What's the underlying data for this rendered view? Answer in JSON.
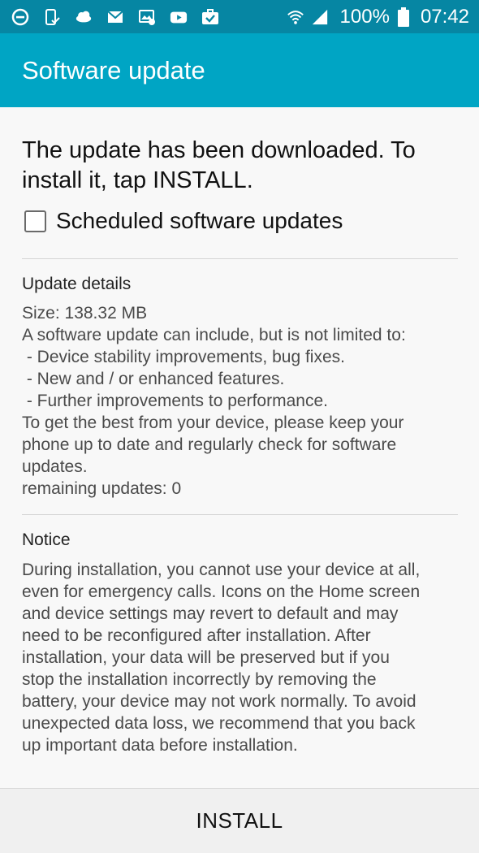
{
  "status_bar": {
    "left_icons": [
      "do-not-disturb-icon",
      "phone-check-icon",
      "cloud-icon",
      "gmail-icon",
      "picture-message-icon",
      "youtube-icon",
      "briefcase-check-icon"
    ],
    "right_icons": [
      "wifi-icon",
      "signal-icon",
      "battery-icon"
    ],
    "battery": "100%",
    "time": "07:42"
  },
  "app_bar": {
    "title": "Software update"
  },
  "headline": "The update has been downloaded. To install it, tap INSTALL.",
  "scheduled_updates": {
    "label": "Scheduled software updates",
    "checked": false
  },
  "update_details": {
    "title": "Update details",
    "lines": [
      "Size: 138.32 MB",
      "A software update can include, but is not limited to:",
      " - Device stability improvements, bug fixes.",
      " - New and / or enhanced features.",
      " - Further improvements to performance.",
      "To get the best from your device, please keep your",
      "phone up to date and regularly check for software",
      "updates.",
      "remaining updates: 0"
    ]
  },
  "notice": {
    "title": "Notice",
    "lines": [
      "During installation, you cannot use your device at all,",
      "even for emergency calls. Icons on the Home screen",
      "and device settings may revert to default and may",
      "need to be reconfigured after installation. After",
      "installation, your data will be preserved but if you",
      "stop the installation incorrectly by removing the",
      "battery, your device may not work normally. To avoid",
      "unexpected data loss, we recommend that you back",
      "up important data before installation."
    ]
  },
  "install_button": {
    "label": "INSTALL"
  },
  "colors": {
    "status_bar": "#0686a3",
    "app_bar": "#00a5c4",
    "background": "#f8f8f8"
  }
}
